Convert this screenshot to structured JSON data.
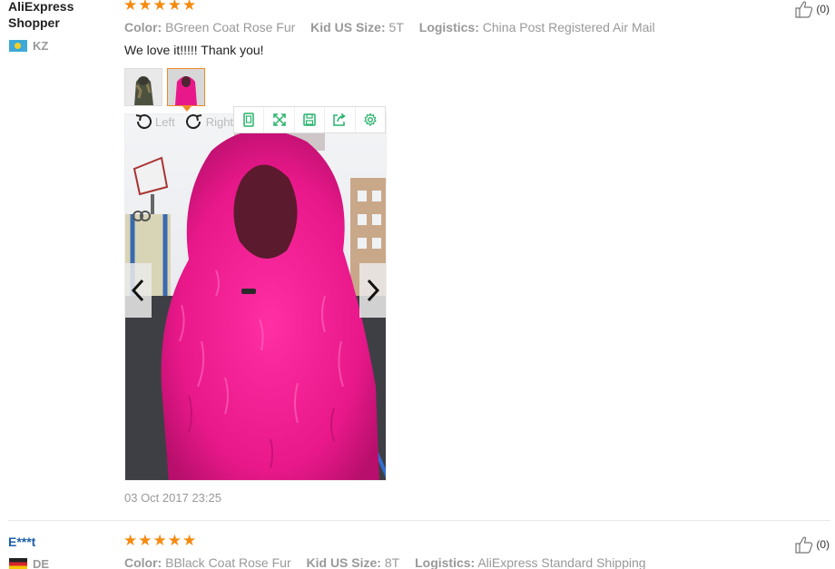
{
  "reviews": [
    {
      "user": "AliExpress Shopper",
      "country": "KZ",
      "rating": 5,
      "color_label": "Color:",
      "color_value": "BGreen Coat Rose Fur",
      "size_label": "Kid US Size:",
      "size_value": "5T",
      "logistics_label": "Logistics:",
      "logistics_value": "China Post Registered Air Mail",
      "helpful_count": "(0)",
      "comment": "We love it!!!!! Thank you!",
      "date": "03 Oct 2017 23:25",
      "viewer": {
        "rotate_left": "Left",
        "rotate_right": "Right"
      }
    },
    {
      "user": "E***t",
      "country": "DE",
      "rating": 5,
      "color_label": "Color:",
      "color_value": "BBlack Coat Rose Fur",
      "size_label": "Kid US Size:",
      "size_value": "8T",
      "logistics_label": "Logistics:",
      "logistics_value": "AliExpress Standard Shipping",
      "helpful_count": "(0)"
    }
  ],
  "icons": {
    "star": "★",
    "toolbar": [
      "fit-icon",
      "fullscreen-icon",
      "save-icon",
      "share-icon",
      "settings-icon"
    ]
  },
  "colors": {
    "star": "#f58a10",
    "accent_green": "#27b36b",
    "active_thumb": "#f08a28",
    "fur_pink": "#e8188a",
    "username_blue": "#1d5fa8"
  }
}
